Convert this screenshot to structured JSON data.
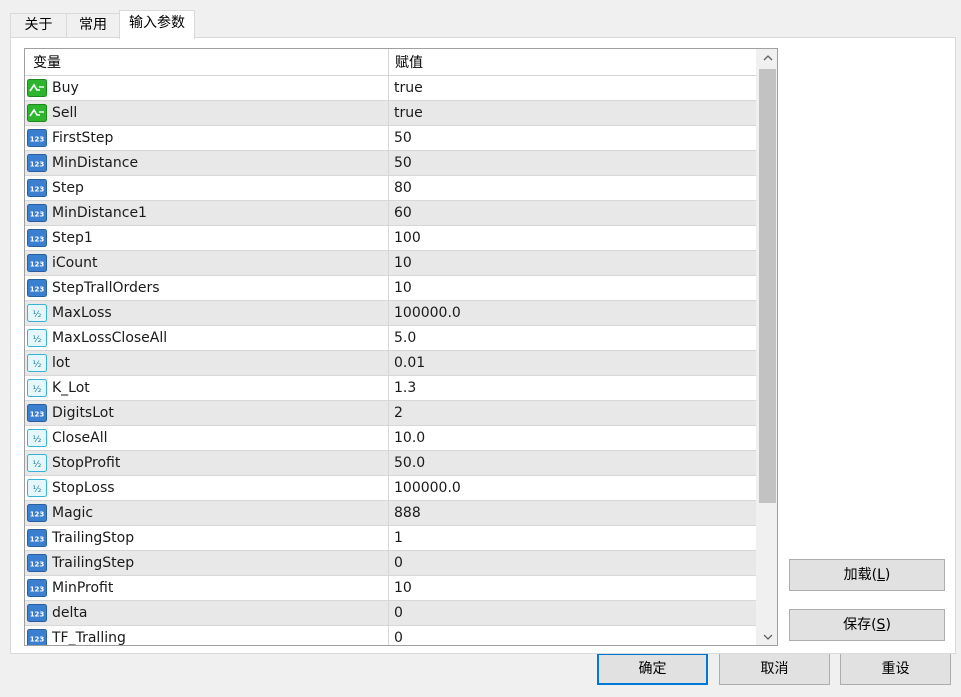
{
  "tabs": [
    {
      "label": "关于"
    },
    {
      "label": "常用"
    },
    {
      "label": "输入参数"
    }
  ],
  "grid": {
    "col_name": "变量",
    "col_value": "赋值",
    "rows": [
      {
        "name": "Buy",
        "value": "true",
        "icon": "bool-icon"
      },
      {
        "name": "Sell",
        "value": "true",
        "icon": "bool-icon"
      },
      {
        "name": "FirstStep",
        "value": "50",
        "icon": "int-icon"
      },
      {
        "name": "MinDistance",
        "value": "50",
        "icon": "int-icon"
      },
      {
        "name": "Step",
        "value": "80",
        "icon": "int-icon"
      },
      {
        "name": "MinDistance1",
        "value": "60",
        "icon": "int-icon"
      },
      {
        "name": "Step1",
        "value": "100",
        "icon": "int-icon"
      },
      {
        "name": "iCount",
        "value": "10",
        "icon": "int-icon"
      },
      {
        "name": "StepTrallOrders",
        "value": "10",
        "icon": "int-icon"
      },
      {
        "name": "MaxLoss",
        "value": "100000.0",
        "icon": "double-icon"
      },
      {
        "name": "MaxLossCloseAll",
        "value": "5.0",
        "icon": "double-icon"
      },
      {
        "name": "lot",
        "value": "0.01",
        "icon": "double-icon"
      },
      {
        "name": "K_Lot",
        "value": "1.3",
        "icon": "double-icon"
      },
      {
        "name": "DigitsLot",
        "value": "2",
        "icon": "int-icon"
      },
      {
        "name": "CloseAll",
        "value": "10.0",
        "icon": "double-icon"
      },
      {
        "name": "StopProfit",
        "value": "50.0",
        "icon": "double-icon"
      },
      {
        "name": "StopLoss",
        "value": "100000.0",
        "icon": "double-icon"
      },
      {
        "name": "Magic",
        "value": "888",
        "icon": "int-icon"
      },
      {
        "name": "TrailingStop",
        "value": "1",
        "icon": "int-icon"
      },
      {
        "name": "TrailingStep",
        "value": "0",
        "icon": "int-icon"
      },
      {
        "name": "MinProfit",
        "value": "10",
        "icon": "int-icon"
      },
      {
        "name": "delta",
        "value": "0",
        "icon": "int-icon"
      },
      {
        "name": "TF_Tralling",
        "value": "0",
        "icon": "int-icon"
      }
    ]
  },
  "buttons": {
    "load": "加载",
    "load_key": "L",
    "save": "保存",
    "save_key": "S",
    "ok": "确定",
    "cancel": "取消",
    "reset": "重设"
  },
  "colors": {
    "primary_border": "#0078d7",
    "bool_icon": "#2db52d",
    "int_icon": "#3a7fd0",
    "double_icon": "#36b3d6"
  }
}
